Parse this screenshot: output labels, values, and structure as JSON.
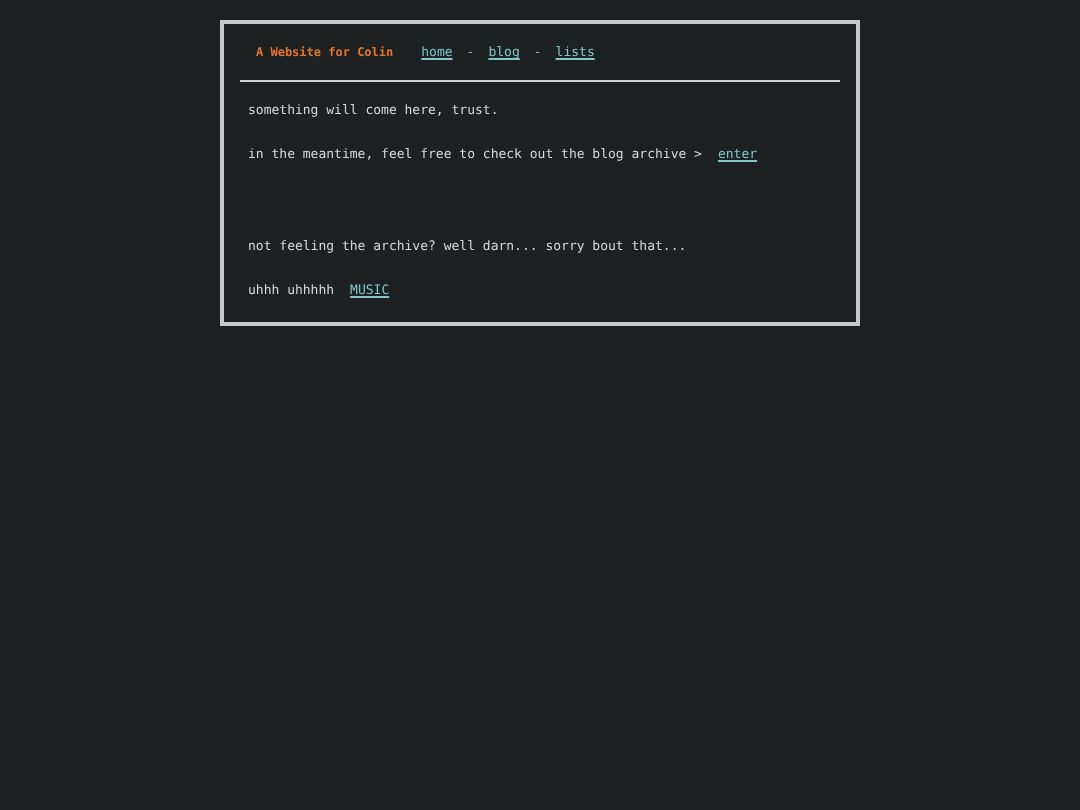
{
  "header": {
    "site_title": "A Website for Colin",
    "nav": [
      {
        "label": "home"
      },
      {
        "label": "blog"
      },
      {
        "label": "lists"
      }
    ],
    "separator": "-"
  },
  "paragraphs": [
    {
      "text": "something will come here, trust."
    },
    {
      "text": "in the meantime, feel free to check out the blog archive >",
      "link": "enter"
    },
    {
      "text": "not feeling the archive? well darn... sorry bout that..."
    },
    {
      "text": "uhhh uhhhhh",
      "link": "MUSIC"
    }
  ]
}
